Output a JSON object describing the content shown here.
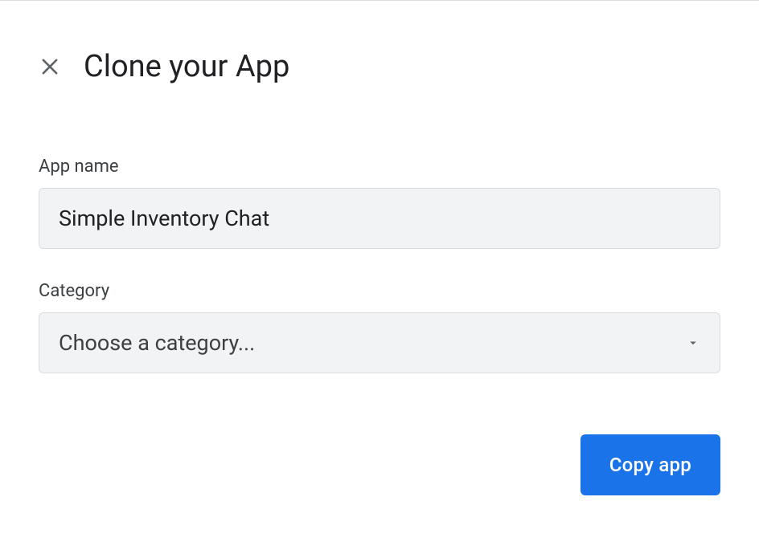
{
  "dialog": {
    "title": "Clone your App"
  },
  "form": {
    "app_name": {
      "label": "App name",
      "value": "Simple Inventory Chat"
    },
    "category": {
      "label": "Category",
      "placeholder": "Choose a category..."
    }
  },
  "actions": {
    "copy_label": "Copy app"
  }
}
